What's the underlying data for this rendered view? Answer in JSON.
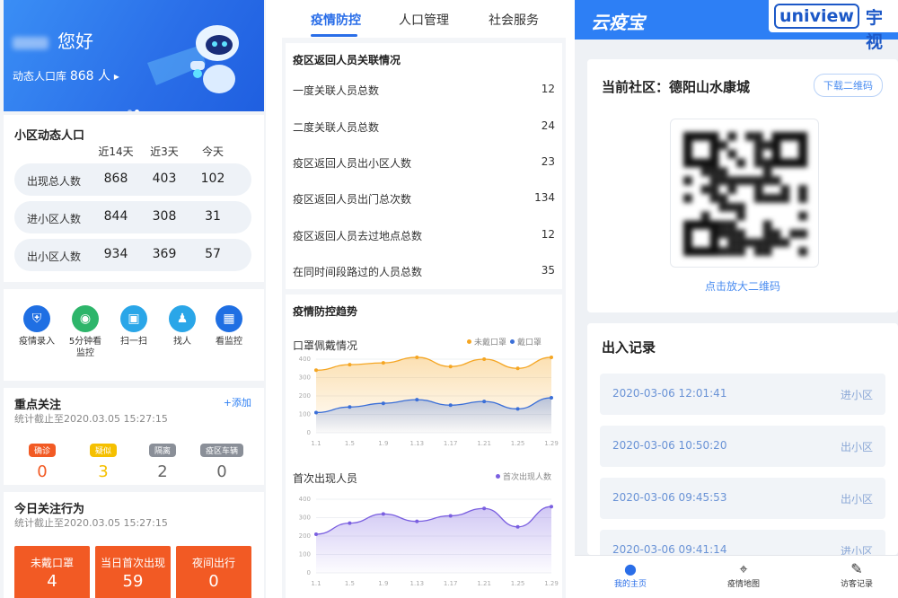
{
  "screen1": {
    "banner": {
      "greeting": "您好",
      "sub_label": "动态人口库",
      "sub_value": "868 人",
      "sub_arrow": "▸"
    },
    "stats": {
      "title": "小区动态人口",
      "headers": [
        "近14天",
        "近3天",
        "今天"
      ],
      "rows": [
        {
          "label": "出现总人数",
          "values": [
            "868",
            "403",
            "102"
          ]
        },
        {
          "label": "进小区人数",
          "values": [
            "844",
            "308",
            "31"
          ]
        },
        {
          "label": "出小区人数",
          "values": [
            "934",
            "369",
            "57"
          ]
        }
      ]
    },
    "quick_actions": [
      {
        "icon": "shield-icon",
        "glyph": "⛨",
        "label": "疫情录入",
        "color": "#1f6fe3"
      },
      {
        "icon": "camera-icon",
        "glyph": "◉",
        "label": "5分钟看监控",
        "color": "#2db56a"
      },
      {
        "icon": "scan-icon",
        "glyph": "▣",
        "label": "扫一扫",
        "color": "#2aa6e8"
      },
      {
        "icon": "person-search-icon",
        "glyph": "♟",
        "label": "找人",
        "color": "#2aa6e8"
      },
      {
        "icon": "monitor-icon",
        "glyph": "▦",
        "label": "看监控",
        "color": "#1f6fe3"
      }
    ],
    "focus": {
      "title": "重点关注",
      "add": "+添加",
      "stat_time": "统计截止至2020.03.05 15:27:15",
      "tags": [
        {
          "label": "确诊",
          "value": "0",
          "color": "#f25a24"
        },
        {
          "label": "疑似",
          "value": "3",
          "color": "#f5c000"
        },
        {
          "label": "隔离",
          "value": "2",
          "color": "#8a8f98"
        },
        {
          "label": "疫区车辆",
          "value": "0",
          "color": "#8a8f98"
        }
      ]
    },
    "behavior": {
      "title": "今日关注行为",
      "stat_time": "统计截止至2020.03.05 15:27:15",
      "items": [
        {
          "label": "未戴口罩",
          "value": "4"
        },
        {
          "label": "当日首次出现",
          "value": "59"
        },
        {
          "label": "夜间出行",
          "value": "0"
        }
      ]
    }
  },
  "screen2": {
    "tabs": [
      "疫情防控",
      "人口管理",
      "社会服务"
    ],
    "active_tab": 0,
    "relations": {
      "title": "疫区返回人员关联情况",
      "rows": [
        {
          "label": "一度关联人员总数",
          "value": "12"
        },
        {
          "label": "二度关联人员总数",
          "value": "24"
        },
        {
          "label": "疫区返回人员出小区人数",
          "value": "23"
        },
        {
          "label": "疫区返回人员出门总次数",
          "value": "134"
        },
        {
          "label": "疫区返回人员去过地点总数",
          "value": "12"
        },
        {
          "label": "在同时间段路过的人员总数",
          "value": "35"
        }
      ]
    },
    "trend_title": "疫情防控趋势"
  },
  "chart_data": [
    {
      "type": "area",
      "title": "口罩佩戴情况",
      "x": [
        "1.1",
        "1.5",
        "1.9",
        "1.13",
        "1.17",
        "1.21",
        "1.25",
        "1.29"
      ],
      "ylim": [
        0,
        400
      ],
      "yticks": [
        0,
        100,
        200,
        300,
        400
      ],
      "series": [
        {
          "name": "未戴口罩",
          "color": "#f5a623",
          "values": [
            340,
            370,
            380,
            410,
            360,
            400,
            350,
            410
          ]
        },
        {
          "name": "戴口罩",
          "color": "#3b6fd8",
          "values": [
            110,
            140,
            160,
            180,
            150,
            170,
            130,
            190
          ]
        }
      ]
    },
    {
      "type": "area",
      "title": "首次出现人员",
      "x": [
        "1.1",
        "1.5",
        "1.9",
        "1.13",
        "1.17",
        "1.21",
        "1.25",
        "1.29"
      ],
      "ylim": [
        0,
        400
      ],
      "yticks": [
        0,
        100,
        200,
        300,
        400
      ],
      "series": [
        {
          "name": "首次出现人数",
          "color": "#7a5fe0",
          "values": [
            210,
            270,
            320,
            280,
            310,
            350,
            250,
            360
          ]
        }
      ]
    }
  ],
  "screen3": {
    "app_title": "云疫宝",
    "brand_a": "uniview",
    "brand_b": "宇视",
    "community": {
      "title": "当前社区：德阳山水康城",
      "download": "下载二维码",
      "enlarge": "点击放大二维码"
    },
    "records": {
      "title": "出入记录",
      "rows": [
        {
          "time": "2020-03-06 12:01:41",
          "dir": "进小区"
        },
        {
          "time": "2020-03-06 10:50:20",
          "dir": "出小区"
        },
        {
          "time": "2020-03-06 09:45:53",
          "dir": "出小区"
        },
        {
          "time": "2020-03-06 09:41:14",
          "dir": "进小区"
        }
      ]
    },
    "nav": [
      {
        "icon": "person-icon",
        "glyph": "●",
        "label": "我的主页"
      },
      {
        "icon": "map-pin-icon",
        "glyph": "⌖",
        "label": "疫情地图"
      },
      {
        "icon": "edit-doc-icon",
        "glyph": "✎",
        "label": "访客记录"
      }
    ]
  }
}
